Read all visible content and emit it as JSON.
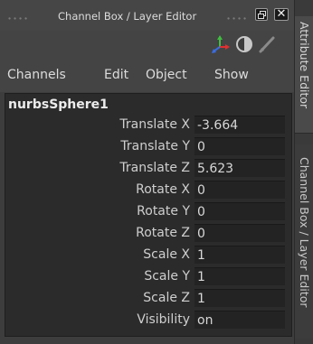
{
  "window": {
    "title": "Channel Box / Layer Editor"
  },
  "menus": [
    "Channels",
    "Edit",
    "Object",
    "Show"
  ],
  "node": {
    "name": "nurbsSphere1"
  },
  "channels": [
    {
      "label": "Translate X",
      "value": "-3.664"
    },
    {
      "label": "Translate Y",
      "value": "0"
    },
    {
      "label": "Translate Z",
      "value": "5.623"
    },
    {
      "label": "Rotate X",
      "value": "0"
    },
    {
      "label": "Rotate Y",
      "value": "0"
    },
    {
      "label": "Rotate Z",
      "value": "0"
    },
    {
      "label": "Scale X",
      "value": "1"
    },
    {
      "label": "Scale Y",
      "value": "1"
    },
    {
      "label": "Scale Z",
      "value": "1"
    },
    {
      "label": "Visibility",
      "value": "on"
    }
  ],
  "side_tabs": {
    "attribute_editor": "Attribute Editor",
    "channel_box": "Channel Box / Layer Editor"
  },
  "icons": {
    "float": "float-window-icon",
    "close": "close-icon",
    "axis": "axis-manipulator-icon",
    "render": "half-shaded-circle-icon",
    "pen": "pen-icon"
  }
}
